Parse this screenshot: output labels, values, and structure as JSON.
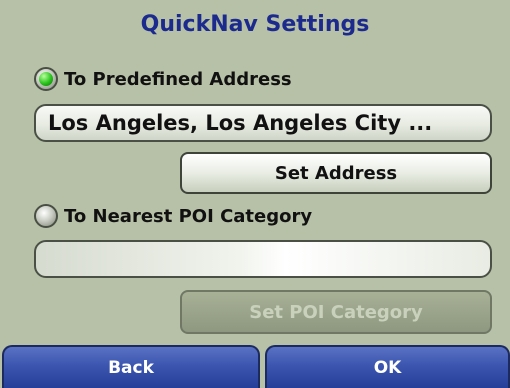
{
  "title": "QuickNav Settings",
  "option_address": {
    "label": "To Predefined Address",
    "selected": true,
    "value": "Los Angeles, Los Angeles City ...",
    "button_label": "Set Address"
  },
  "option_poi": {
    "label": "To Nearest POI Category",
    "selected": false,
    "value": "",
    "button_label": "Set POI Category"
  },
  "footer": {
    "back_label": "Back",
    "ok_label": "OK"
  },
  "colors": {
    "background": "#b7c1a7",
    "title": "#1c2a8e",
    "selected_radio": "#27c31a",
    "footer_button": "#3c56b0"
  }
}
